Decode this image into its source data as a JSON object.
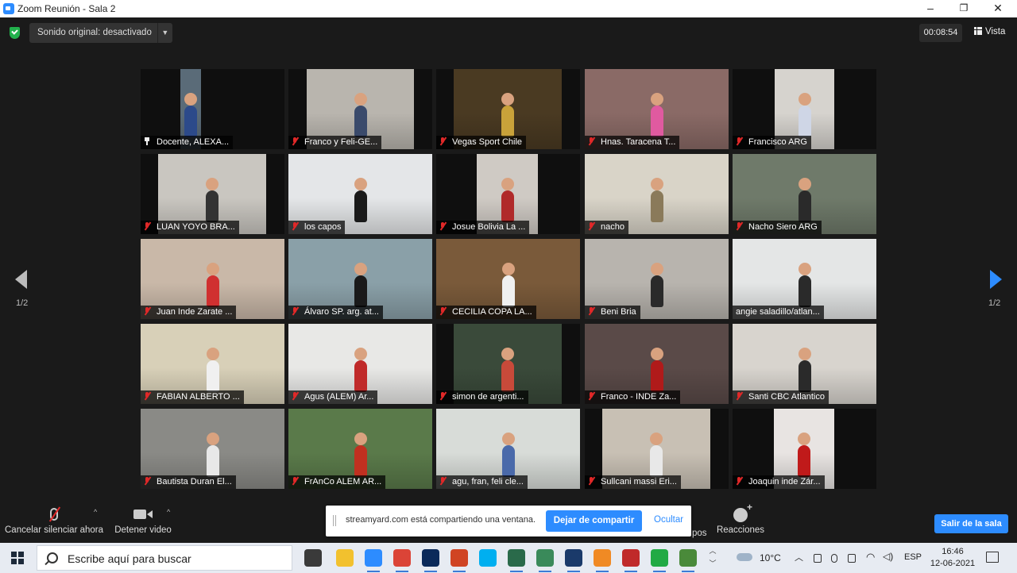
{
  "window": {
    "title": "Zoom Reunión - Sala 2",
    "minimize": "–",
    "maximize": "❐",
    "close": "✕"
  },
  "topbar": {
    "original_sound": "Sonido original: desactivado",
    "timer": "00:08:54",
    "view": "Vista"
  },
  "participants": [
    {
      "name": "Docente, ALEXA...",
      "icon": "pin-icon",
      "bg": "#5a6b78",
      "fg": "#2c4a8a",
      "crop": [
        50,
        76
      ]
    },
    {
      "name": "Franco y Feli-GE...",
      "icon": "mic-muted-icon",
      "bg": "#b9b5ae",
      "fg": "#3a4a6b",
      "crop": [
        23,
        158
      ]
    },
    {
      "name": "Vegas Sport Chile",
      "icon": "mic-muted-icon",
      "bg": "#4a3a22",
      "fg": "#c9a23a",
      "crop": [
        22,
        158
      ]
    },
    {
      "name": "Hnas. Taracena T...",
      "icon": "mic-muted-icon",
      "bg": "#8a6a66",
      "fg": "#e05aa0",
      "crop": [
        0,
        181
      ]
    },
    {
      "name": "Francisco ARG",
      "icon": "mic-muted-icon",
      "bg": "#d6d3ce",
      "fg": "#cfd6e6",
      "crop": [
        53,
        128
      ]
    },
    {
      "name": "LUAN YOYO BRA...",
      "icon": "mic-muted-icon",
      "bg": "#c9c6c0",
      "fg": "#333333",
      "crop": [
        22,
        158
      ]
    },
    {
      "name": "los capos",
      "icon": "mic-muted-icon",
      "bg": "#e4e6e8",
      "fg": "#1a1a1a",
      "crop": [
        0,
        181
      ]
    },
    {
      "name": "Josue Bolivia La ...",
      "icon": "mic-muted-icon",
      "bg": "#cfcac4",
      "fg": "#b02a2a",
      "crop": [
        51,
        128
      ]
    },
    {
      "name": "nacho",
      "icon": "mic-muted-icon",
      "bg": "#d9d4c8",
      "fg": "#8a7a5a",
      "crop": [
        0,
        181
      ]
    },
    {
      "name": "Nacho Siero ARG",
      "icon": "mic-muted-icon",
      "bg": "#6f7a6a",
      "fg": "#2a2a2a",
      "crop": [
        0,
        181
      ]
    },
    {
      "name": "Juan Inde Zarate ...",
      "icon": "mic-muted-icon",
      "bg": "#c9b8a8",
      "fg": "#d03030",
      "crop": [
        0,
        181
      ]
    },
    {
      "name": "Álvaro SP. arg. at...",
      "icon": "mic-muted-icon",
      "bg": "#8aa0a8",
      "fg": "#1a1a1a",
      "crop": [
        0,
        181
      ]
    },
    {
      "name": "CECILIA COPA LA...",
      "icon": "mic-muted-icon",
      "bg": "#7a5a3a",
      "fg": "#f0f0f0",
      "crop": [
        0,
        181
      ]
    },
    {
      "name": "Beni Bria",
      "icon": "mic-muted-icon",
      "bg": "#b8b4ae",
      "fg": "#2a2a2a",
      "crop": [
        0,
        181
      ]
    },
    {
      "name": "angie saladillo/atlan...",
      "icon": "none",
      "bg": "#e4e6e6",
      "fg": "#2a2a2a",
      "crop": [
        0,
        181
      ]
    },
    {
      "name": "FABIAN ALBERTO ...",
      "icon": "mic-muted-icon",
      "bg": "#d8d0b8",
      "fg": "#f0f0f0",
      "crop": [
        0,
        181
      ]
    },
    {
      "name": "Agus (ALEM) Ar...",
      "icon": "mic-muted-icon",
      "bg": "#e8e8e6",
      "fg": "#c02a2a",
      "crop": [
        0,
        181
      ]
    },
    {
      "name": "simon de argenti...",
      "icon": "mic-muted-icon",
      "bg": "#3a4a3a",
      "fg": "#c84a3a",
      "crop": [
        22,
        158
      ]
    },
    {
      "name": "Franco - INDE Za...",
      "icon": "mic-muted-icon",
      "bg": "#5a4a48",
      "fg": "#b01a1a",
      "crop": [
        0,
        181
      ]
    },
    {
      "name": "Santi CBC Atlantico",
      "icon": "mic-muted-icon",
      "bg": "#d8d4ce",
      "fg": "#2a2a2a",
      "crop": [
        0,
        181
      ]
    },
    {
      "name": "Bautista Duran El...",
      "icon": "mic-muted-icon",
      "bg": "#8a8a86",
      "fg": "#e8e8e8",
      "crop": [
        0,
        181
      ]
    },
    {
      "name": "FrAnCo ALEM AR...",
      "icon": "mic-muted-icon",
      "bg": "#5a7a4a",
      "fg": "#c03020",
      "crop": [
        0,
        181
      ]
    },
    {
      "name": "agu, fran, feli cle...",
      "icon": "mic-muted-icon",
      "bg": "#d8dcd8",
      "fg": "#4a6aaa",
      "crop": [
        0,
        181
      ]
    },
    {
      "name": "Sullcani massi Eri...",
      "icon": "mic-muted-icon",
      "bg": "#c8c0b4",
      "fg": "#e8e8e8",
      "crop": [
        22,
        158
      ]
    },
    {
      "name": "Joaquin inde Zár...",
      "icon": "mic-muted-icon",
      "bg": "#e8e4e2",
      "fg": "#c01a1a",
      "crop": [
        52,
        128
      ]
    }
  ],
  "pager": {
    "left": "1/2",
    "right": "1/2"
  },
  "controls": {
    "unmute": "Cancelar silenciar ahora",
    "stop_video": "Detener video",
    "caret": "^",
    "reactions": "Reacciones",
    "hidden_fragment": "pos",
    "leave": "Salir de la sala"
  },
  "share_banner": {
    "message": "streamyard.com está compartiendo una ventana.",
    "stop": "Dejar de compartir",
    "hide": "Ocultar"
  },
  "taskbar": {
    "search_placeholder": "Escribe aquí para buscar",
    "apps": [
      {
        "name": "task-view-icon",
        "color": "#3a3a3a"
      },
      {
        "name": "file-explorer-icon",
        "color": "#f2c12e"
      },
      {
        "name": "zoom-app-icon",
        "color": "#2d8cff"
      },
      {
        "name": "chrome-icon",
        "color": "#db4437"
      },
      {
        "name": "photoshop-icon",
        "color": "#0b2a5a"
      },
      {
        "name": "powerpoint-icon",
        "color": "#d04423"
      },
      {
        "name": "skype-icon",
        "color": "#00aff0"
      },
      {
        "name": "vpn-icon",
        "color": "#2a6a4a"
      },
      {
        "name": "photo-app-icon",
        "color": "#3a8a5a"
      },
      {
        "name": "network-app-icon",
        "color": "#1a3a6a"
      },
      {
        "name": "cast-app-icon",
        "color": "#f08a24"
      },
      {
        "name": "record-app-icon",
        "color": "#c02a2a"
      },
      {
        "name": "phone-app-icon",
        "color": "#22aa44"
      },
      {
        "name": "browser-icon",
        "color": "#4a8a3a"
      }
    ],
    "temperature": "10°C",
    "language": "ESP",
    "time": "16:46",
    "date": "12-06-2021"
  },
  "colors": {
    "accent": "#2d8cff",
    "muted_red": "#e02828",
    "active_speaker": "#e5e040"
  }
}
